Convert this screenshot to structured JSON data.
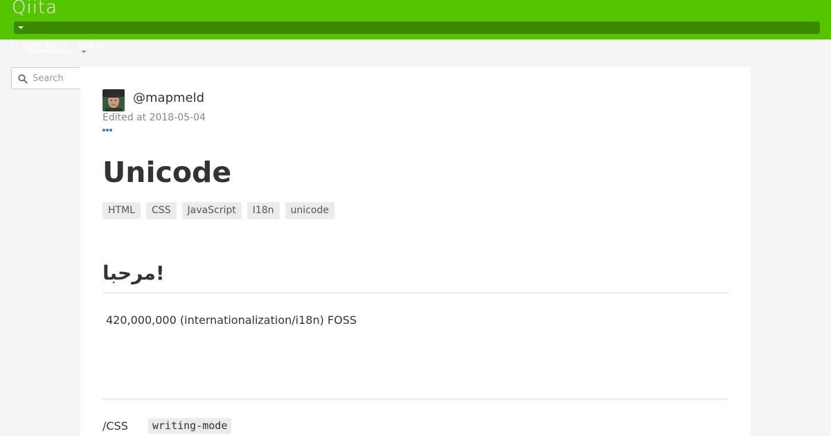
{
  "header": {
    "logo": "Qiita",
    "signup_label": "Sign up",
    "login_label": "Log in",
    "community_label": "Community",
    "brand_color": "#55c500",
    "bar_color": "#3b8a00"
  },
  "search": {
    "placeholder": "Search",
    "value": ""
  },
  "article": {
    "author": "@mapmeld",
    "edited": "Edited at 2018-05-04",
    "title": "Unicode",
    "tags": [
      "HTML",
      "CSS",
      "JavaScript",
      "I18n",
      "unicode"
    ],
    "heading": "مرحبا!",
    "paragraph": "420,000,000 (internationalization/i18n) FOSS",
    "bottom_label": "/CSS",
    "code": "writing-mode"
  }
}
